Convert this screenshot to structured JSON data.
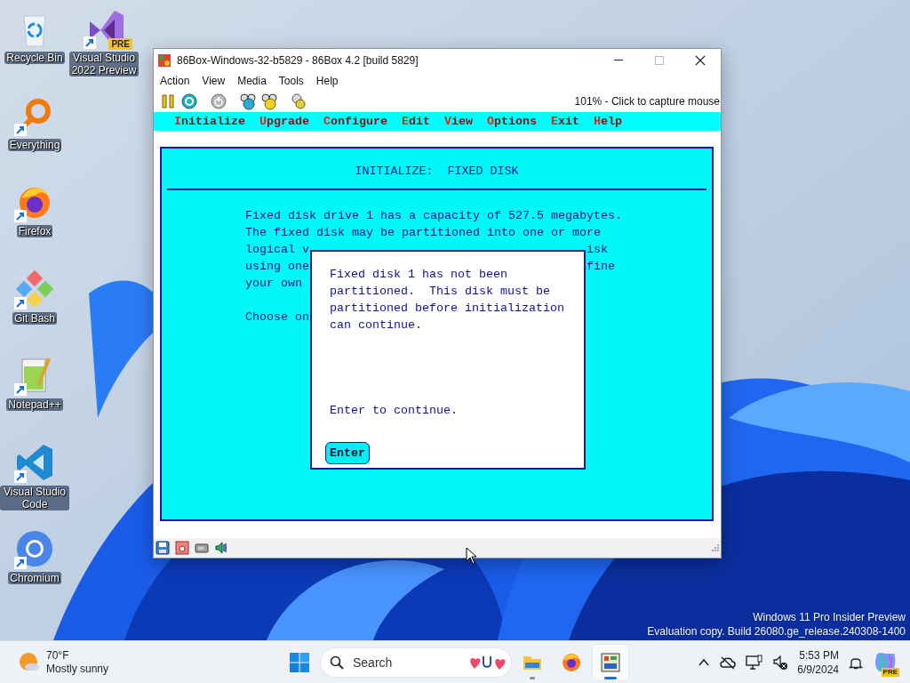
{
  "desktop": {
    "icons": [
      {
        "label": "Recycle Bin",
        "kind": "bin",
        "shortcut": false
      },
      {
        "label": "Everything",
        "kind": "everything",
        "shortcut": true
      },
      {
        "label": "Firefox",
        "kind": "firefox",
        "shortcut": true
      },
      {
        "label": "Git Bash",
        "kind": "git",
        "shortcut": true
      },
      {
        "label": "Notepad++",
        "kind": "notepad",
        "shortcut": true
      },
      {
        "label": "Visual Studio Code",
        "kind": "vscode",
        "shortcut": true
      },
      {
        "label": "Chromium",
        "kind": "chromium",
        "shortcut": true
      },
      {
        "label": "Visual Studio 2022 Preview",
        "kind": "vs",
        "shortcut": true,
        "badge": "PRE"
      }
    ],
    "edition_notice": [
      "Windows 11 Pro Insider Preview",
      "Evaluation copy. Build 26080.ge_release.240308-1400"
    ]
  },
  "window": {
    "title": "86Box-Windows-32-b5829 - 86Box 4.2 [build 5829]",
    "controls": [
      {
        "kind": "minimize",
        "disabled": false
      },
      {
        "kind": "maximize",
        "disabled": true
      },
      {
        "kind": "close",
        "disabled": false
      }
    ],
    "menu": [
      "Action",
      "View",
      "Media",
      "Tools",
      "Help"
    ],
    "toolbar_status": "101% - Click to capture mouse",
    "dos": {
      "menu": [
        "Initialize",
        "Upgrade",
        "Configure",
        "Edit",
        "View",
        "Options",
        "Exit",
        "Help"
      ],
      "heading": "INITIALIZE:  FIXED DISK",
      "paragraphs": [
        [
          {
            "left": "Fixed disk drive 1 has a capacity of 527.5 megabytes."
          },
          {
            "left": "The fixed disk may be partitioned into one or more"
          },
          {
            "left": "logical v",
            "right": "isk"
          },
          {
            "left": "using one",
            "right": "fine"
          },
          {
            "left": "your own"
          }
        ],
        [
          {
            "left": "Choose on"
          }
        ]
      ],
      "dialog": {
        "message": "Fixed disk 1 has not been\npartitioned.  This disk must be\npartitioned before initialization\ncan continue.",
        "prompt": "Enter to continue.",
        "button": "Enter"
      }
    }
  },
  "taskbar": {
    "weather": {
      "temperature": "70°F",
      "condition": "Mostly sunny"
    },
    "search": {
      "placeholder": "Search"
    },
    "apps": [
      {
        "kind": "explorer",
        "running": true,
        "active": false
      },
      {
        "kind": "firefox",
        "running": false,
        "active": false
      },
      {
        "kind": "emulator",
        "running": true,
        "active": true
      }
    ],
    "clock": {
      "time": "5:53 PM",
      "date": "6/9/2024"
    },
    "copilot_badge": "PRE"
  }
}
